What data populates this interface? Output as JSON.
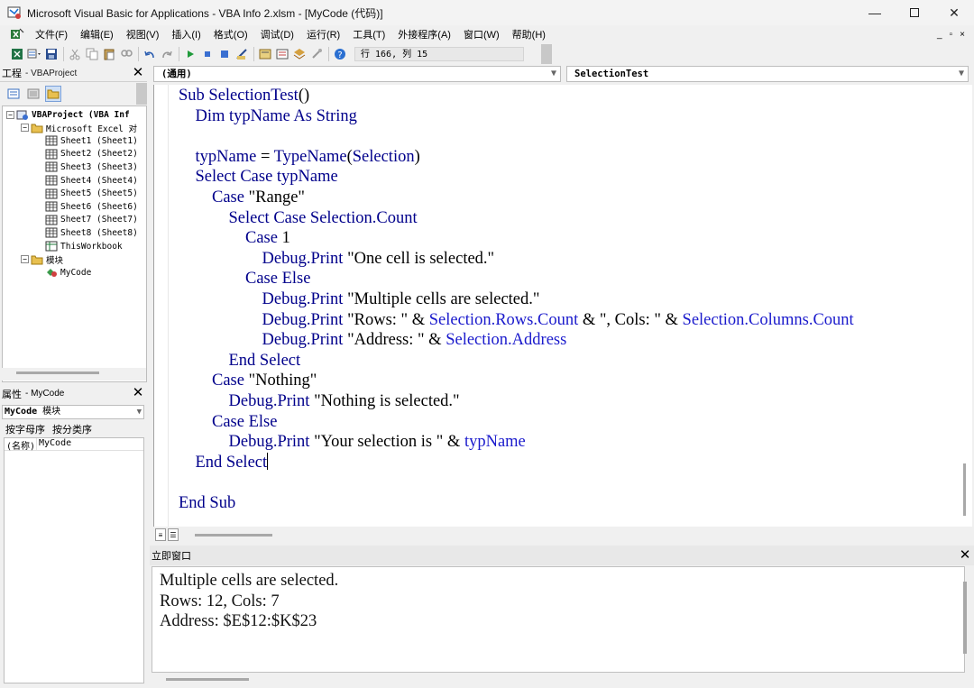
{
  "window": {
    "title": "Microsoft Visual Basic for Applications - VBA Info 2.xlsm - [MyCode (代码)]",
    "minimize_icon": "minimize-icon",
    "maximize_icon": "maximize-icon",
    "close_icon": "close-icon"
  },
  "menu": {
    "items": [
      "文件(F)",
      "编辑(E)",
      "视图(V)",
      "插入(I)",
      "格式(O)",
      "调试(D)",
      "运行(R)",
      "工具(T)",
      "外接程序(A)",
      "窗口(W)",
      "帮助(H)"
    ]
  },
  "mdi": {
    "minimize": "_",
    "restore": "▫",
    "close": "×"
  },
  "toolbar": {
    "status": "行 166, 列 15"
  },
  "project": {
    "title": "工程",
    "subtitle": "- VBAProject",
    "tree": [
      {
        "label": "VBAProject (VBA Inf",
        "level": 0,
        "expander": "⊟",
        "icon": "vba-project-icon",
        "bold": true
      },
      {
        "label": "Microsoft Excel 对",
        "level": 1,
        "expander": "⊟",
        "icon": "folder-icon"
      },
      {
        "label": "Sheet1 (Sheet1)",
        "level": 2,
        "icon": "sheet-icon"
      },
      {
        "label": "Sheet2 (Sheet2)",
        "level": 2,
        "icon": "sheet-icon"
      },
      {
        "label": "Sheet3 (Sheet3)",
        "level": 2,
        "icon": "sheet-icon"
      },
      {
        "label": "Sheet4 (Sheet4)",
        "level": 2,
        "icon": "sheet-icon"
      },
      {
        "label": "Sheet5 (Sheet5)",
        "level": 2,
        "icon": "sheet-icon"
      },
      {
        "label": "Sheet6 (Sheet6)",
        "level": 2,
        "icon": "sheet-icon"
      },
      {
        "label": "Sheet7 (Sheet7)",
        "level": 2,
        "icon": "sheet-icon"
      },
      {
        "label": "Sheet8 (Sheet8)",
        "level": 2,
        "icon": "sheet-icon"
      },
      {
        "label": "ThisWorkbook",
        "level": 2,
        "icon": "workbook-icon"
      },
      {
        "label": "模块",
        "level": 1,
        "expander": "⊟",
        "icon": "folder-icon"
      },
      {
        "label": "MyCode",
        "level": 2,
        "icon": "module-icon"
      }
    ]
  },
  "properties": {
    "title": "属性",
    "subtitle": "- MyCode",
    "selected_object": "MyCode",
    "selected_type": "模块",
    "tab_alpha": "按字母序",
    "tab_category": "按分类序",
    "rows": [
      {
        "key": "(名称)",
        "value": "MyCode"
      }
    ]
  },
  "code": {
    "object_dropdown": "(通用)",
    "procedure_dropdown": "SelectionTest",
    "lines": [
      [
        {
          "t": "Sub SelectionTest",
          "c": "k"
        },
        {
          "t": "()",
          "c": "t"
        }
      ],
      [
        {
          "t": "    Dim typName As String",
          "c": "k"
        }
      ],
      [],
      [
        {
          "t": "    typName",
          "c": "k"
        },
        {
          "t": " = ",
          "c": "t"
        },
        {
          "t": "TypeName",
          "c": "k"
        },
        {
          "t": "(",
          "c": "t"
        },
        {
          "t": "Selection",
          "c": "k"
        },
        {
          "t": ")",
          "c": "t"
        }
      ],
      [
        {
          "t": "    Select Case typName",
          "c": "k"
        }
      ],
      [
        {
          "t": "        Case ",
          "c": "k"
        },
        {
          "t": "\"Range\"",
          "c": "t"
        }
      ],
      [
        {
          "t": "            Select Case Selection.Count",
          "c": "k"
        }
      ],
      [
        {
          "t": "                Case ",
          "c": "k"
        },
        {
          "t": "1",
          "c": "t"
        }
      ],
      [
        {
          "t": "                    Debug.Print",
          "c": "k"
        },
        {
          "t": " \"One cell is selected.\"",
          "c": "t"
        }
      ],
      [
        {
          "t": "                Case Else",
          "c": "k"
        }
      ],
      [
        {
          "t": "                    Debug.Print",
          "c": "k"
        },
        {
          "t": " \"Multiple cells are selected.\"",
          "c": "t"
        }
      ],
      [
        {
          "t": "                    Debug.Print",
          "c": "k"
        },
        {
          "t": " \"Rows: \" & ",
          "c": "t"
        },
        {
          "t": "Selection.Rows.Count",
          "c": "b"
        },
        {
          "t": " & \", Cols: \" & ",
          "c": "t"
        },
        {
          "t": "Selection.Columns.Count",
          "c": "b"
        }
      ],
      [
        {
          "t": "                    Debug.Print",
          "c": "k"
        },
        {
          "t": " \"Address: \" & ",
          "c": "t"
        },
        {
          "t": "Selection.Address",
          "c": "b"
        }
      ],
      [
        {
          "t": "            End Select",
          "c": "k"
        }
      ],
      [
        {
          "t": "        Case ",
          "c": "k"
        },
        {
          "t": "\"Nothing\"",
          "c": "t"
        }
      ],
      [
        {
          "t": "            Debug.Print",
          "c": "k"
        },
        {
          "t": " \"Nothing is selected.\"",
          "c": "t"
        }
      ],
      [
        {
          "t": "        Case Else",
          "c": "k"
        }
      ],
      [
        {
          "t": "            Debug.Print",
          "c": "k"
        },
        {
          "t": " \"Your selection is \" & ",
          "c": "t"
        },
        {
          "t": "typName",
          "c": "b"
        }
      ],
      [
        {
          "t": "    End Select",
          "c": "k"
        },
        {
          "t": "|",
          "c": "caret"
        }
      ],
      [],
      [
        {
          "t": "End Sub",
          "c": "k"
        }
      ]
    ]
  },
  "immediate": {
    "title": "立即窗口",
    "lines": [
      "Multiple cells are selected.",
      "Rows: 12, Cols: 7",
      "Address: $E$12:$K$23"
    ]
  },
  "colors": {
    "keyword": "#00008b",
    "identifier": "#1a1acc",
    "text": "#000000",
    "chrome": "#f0f0f0"
  }
}
